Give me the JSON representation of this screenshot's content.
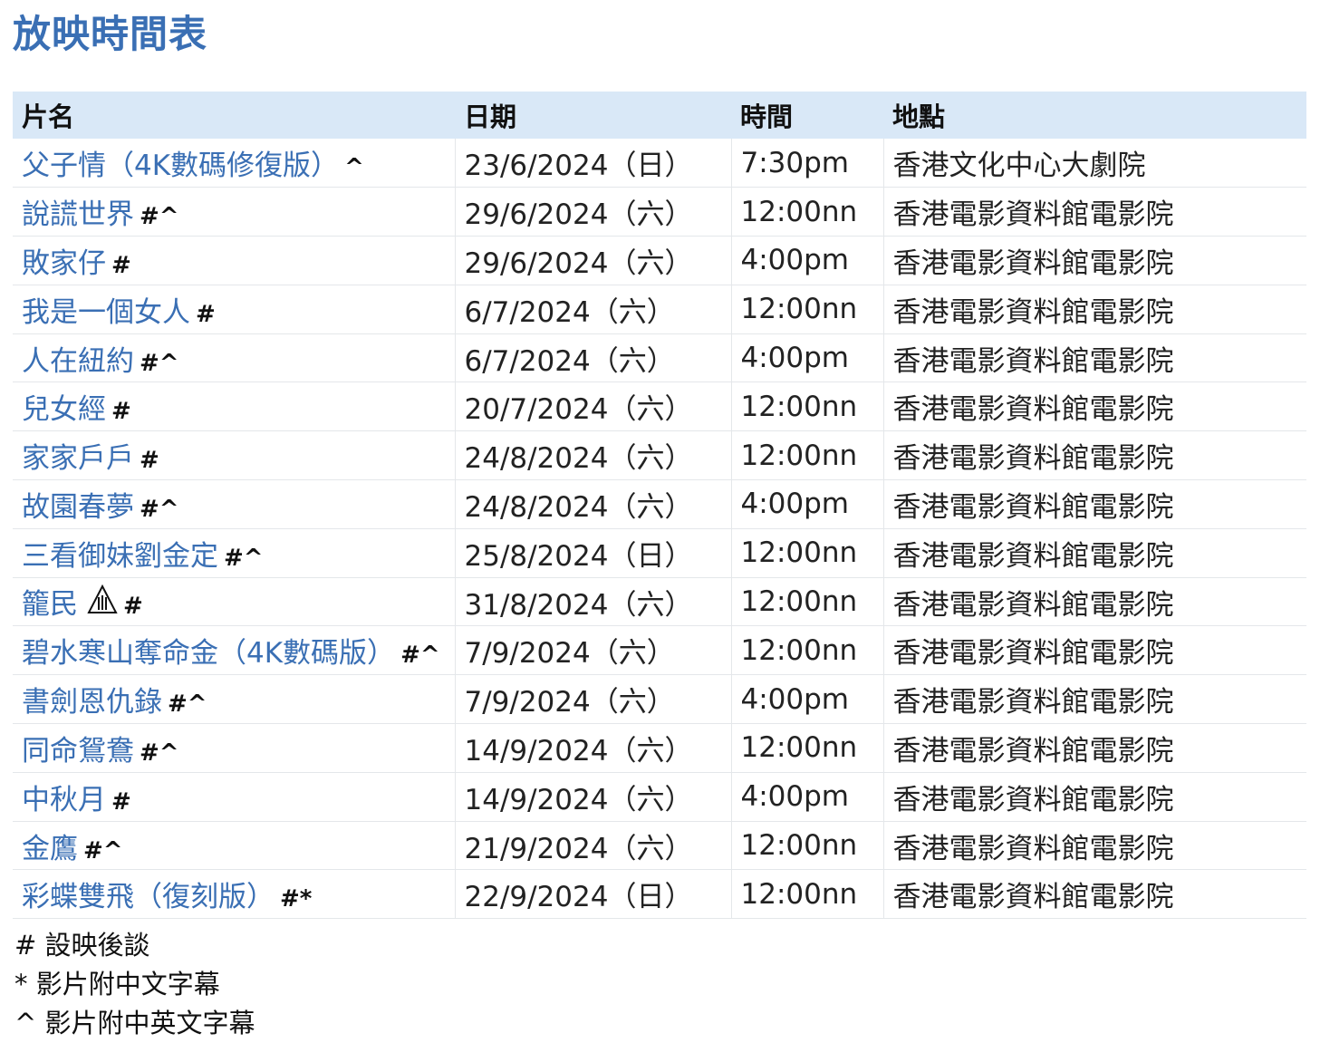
{
  "page": {
    "title": "放映時間表"
  },
  "table": {
    "headers": [
      "片名",
      "日期",
      "時間",
      "地點"
    ],
    "rows": [
      {
        "film": "父子情（4K數碼修復版）",
        "marks": "^",
        "date": "23/6/2024（日）",
        "time": "7:30pm",
        "venue": "香港文化中心大劇院"
      },
      {
        "film": "說謊世界",
        "marks": "#^",
        "date": "29/6/2024（六）",
        "time": "12:00nn",
        "venue": "香港電影資料館電影院"
      },
      {
        "film": "敗家仔",
        "marks": "#",
        "date": "29/6/2024（六）",
        "time": "4:00pm",
        "venue": "香港電影資料館電影院"
      },
      {
        "film": "我是一個女人",
        "marks": "#",
        "date": "6/7/2024（六）",
        "time": "12:00nn",
        "venue": "香港電影資料館電影院"
      },
      {
        "film": "人在紐約",
        "marks": "#^",
        "date": "6/7/2024（六）",
        "time": "4:00pm",
        "venue": "香港電影資料館電影院"
      },
      {
        "film": "兒女經",
        "marks": "#",
        "date": "20/7/2024（六）",
        "time": "12:00nn",
        "venue": "香港電影資料館電影院"
      },
      {
        "film": "家家戶戶",
        "marks": "#",
        "date": "24/8/2024（六）",
        "time": "12:00nn",
        "venue": "香港電影資料館電影院"
      },
      {
        "film": "故園春夢",
        "marks": "#^",
        "date": "24/8/2024（六）",
        "time": "4:00pm",
        "venue": "香港電影資料館電影院"
      },
      {
        "film": "三看御妹劉金定",
        "marks": "#^",
        "date": "25/8/2024（日）",
        "time": "12:00nn",
        "venue": "香港電影資料館電影院"
      },
      {
        "film": "籠民",
        "marks": "#",
        "icon": "category-iii-rating-icon",
        "date": "31/8/2024（六）",
        "time": "12:00nn",
        "venue": "香港電影資料館電影院"
      },
      {
        "film": "碧水寒山奪命金（4K數碼版）",
        "marks": "#^",
        "date": "7/9/2024（六）",
        "time": "12:00nn",
        "venue": "香港電影資料館電影院"
      },
      {
        "film": "書劍恩仇錄",
        "marks": "#^",
        "date": "7/9/2024（六）",
        "time": "4:00pm",
        "venue": "香港電影資料館電影院"
      },
      {
        "film": "同命鴛鴦",
        "marks": "#^",
        "date": "14/9/2024（六）",
        "time": "12:00nn",
        "venue": "香港電影資料館電影院"
      },
      {
        "film": "中秋月",
        "marks": "#",
        "date": "14/9/2024（六）",
        "time": "4:00pm",
        "venue": "香港電影資料館電影院"
      },
      {
        "film": "金鷹",
        "marks": "#^",
        "date": "21/9/2024（六）",
        "time": "12:00nn",
        "venue": "香港電影資料館電影院"
      },
      {
        "film": "彩蝶雙飛（復刻版）",
        "marks": "#*",
        "date": "22/9/2024（日）",
        "time": "12:00nn",
        "venue": "香港電影資料館電影院"
      }
    ]
  },
  "footnotes": [
    "# 設映後談",
    "* 影片附中文字幕",
    "^ 影片附中英文字幕"
  ],
  "colors": {
    "title": "#3a6fb4",
    "link": "#3a6fb4",
    "header_bg": "#d9e8f7",
    "row_border": "#e4e7ea"
  }
}
